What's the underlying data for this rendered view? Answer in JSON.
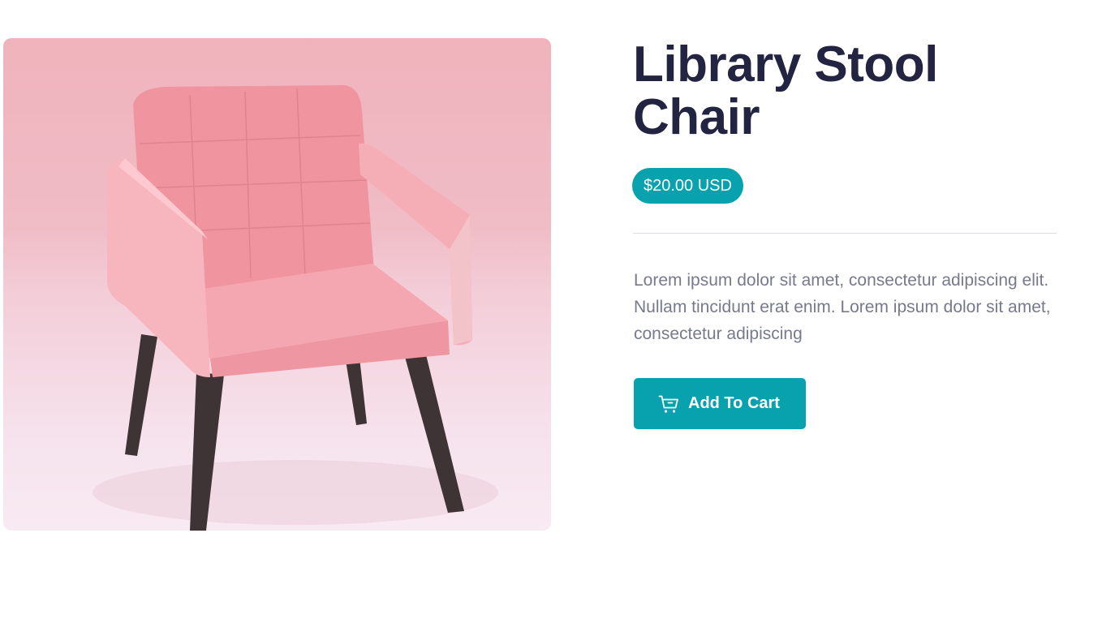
{
  "product": {
    "title": "Library Stool Chair",
    "image_alt": "Pink upholstered armchair with dark wooden legs",
    "price": "$20.00 USD",
    "description": "Lorem ipsum dolor sit amet, consectetur adipiscing elit. Nullam tincidunt erat enim. Lorem ipsum dolor sit amet, consectetur adipiscing",
    "add_to_cart_label": "Add To Cart"
  },
  "icons": {
    "cart": "shopping-cart-icon"
  },
  "colors": {
    "accent": "#07a2ad",
    "title": "#232342",
    "body_text": "#777a8e",
    "divider": "#dcdde2",
    "chair": "#f3a2aa",
    "legs": "#3e3436"
  }
}
